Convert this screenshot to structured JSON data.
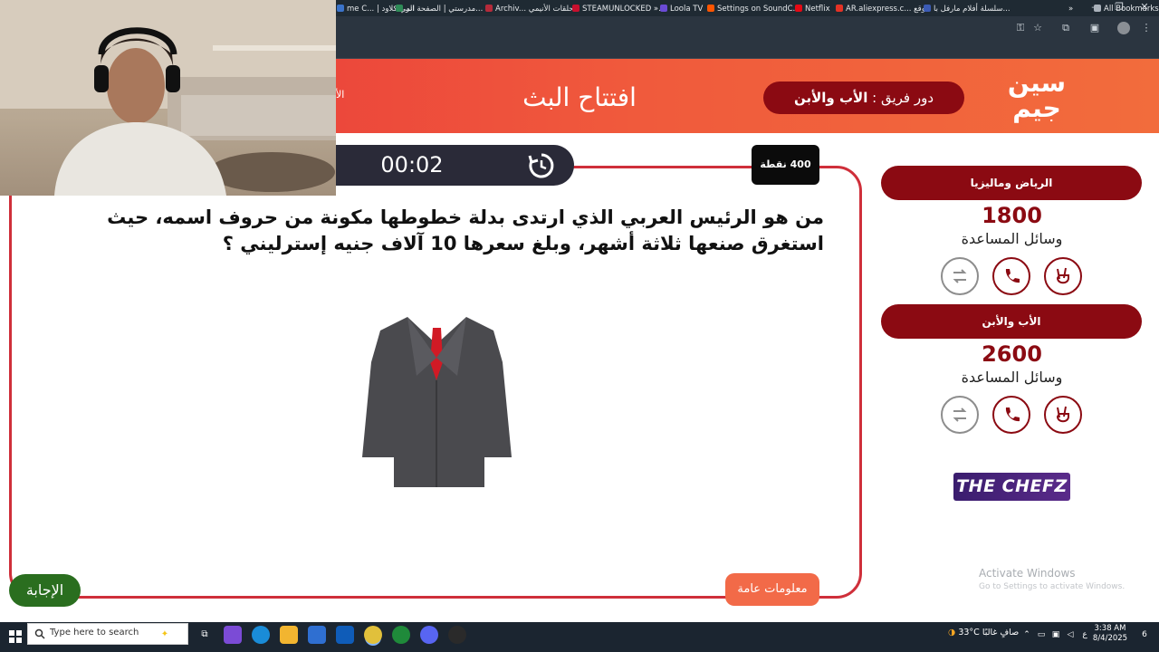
{
  "browser": {
    "window_controls": [
      "–",
      "❐",
      "✕"
    ],
    "bookmarks": [
      {
        "label": "me C... | انمي كلاود",
        "color": "#3b73c9"
      },
      {
        "label": "انمي كلاود | الصفحة الر...",
        "color": "#2e8b57"
      },
      {
        "label": "مدرستي | الصفحة الر...",
        "color": "#2e8b57"
      },
      {
        "label": "Archiv... حلقات الأنيمي",
        "color": "#b52a3a"
      },
      {
        "label": "STEAMUNLOCKED »...",
        "color": "#c8102e"
      },
      {
        "label": "Loola TV",
        "color": "#6b4bd6"
      },
      {
        "label": "Settings on SoundC...",
        "color": "#ff5500"
      },
      {
        "label": "Netflix",
        "color": "#e50914"
      },
      {
        "label": "AR.aliexpress.c... موقع",
        "color": "#e43225"
      },
      {
        "label": "سلسلة أفلام مارفل با...",
        "color": "#3b5bb5"
      },
      {
        "label": "All Bookmarks",
        "color": "#aab2bb"
      }
    ],
    "overflow_label": "»"
  },
  "header": {
    "stream_title": "افتتاح البث",
    "team_turn_prefix": "دور فريق : ",
    "team_turn_name": "الأب والأبن",
    "logo_text_top": "سين",
    "logo_text_bottom": "جيم",
    "clipped_text": "الأ"
  },
  "question_card": {
    "timer": "00:02",
    "points": "400 نقطة",
    "question": "من هو الرئيس العربي الذي ارتدى بدلة خطوطها مكونة من حروف اسمه، حيث استغرق صنعها ثلاثة أشهر، وبلغ سعرها 10 آلاف جنيه إسترليني ؟",
    "image_subject": "suit-jacket",
    "category": "معلومات عامة",
    "answer_button": "الإجابة"
  },
  "teams": [
    {
      "name": "الرياض وماليزيا",
      "score": "1800",
      "aids_label": "وسائل المساعدة",
      "aids": [
        {
          "icon": "swap-icon",
          "used": true
        },
        {
          "icon": "phone-icon",
          "used": false
        },
        {
          "icon": "two-fingers-icon",
          "used": false
        }
      ]
    },
    {
      "name": "الأب والأبن",
      "score": "2600",
      "aids_label": "وسائل المساعدة",
      "aids": [
        {
          "icon": "swap-icon",
          "used": true
        },
        {
          "icon": "phone-icon",
          "used": false
        },
        {
          "icon": "two-fingers-icon",
          "used": false
        }
      ]
    }
  ],
  "sponsor": "THE CHEFZ",
  "watermark": {
    "line1": "Activate Windows",
    "line2": "Go to Settings to activate Windows."
  },
  "taskbar": {
    "search_placeholder": "Type here to search",
    "weather": "33°C صافٍ غالبًا",
    "lang": "ع",
    "time": "3:38 AM",
    "date": "8/4/2025",
    "notification_count": "6"
  },
  "colors": {
    "accent_dark_red": "#8b0a12",
    "header_red": "#e8343a",
    "card_border": "#cf2f3a",
    "answer_green": "#2a6e1f",
    "category_orange": "#f26a48"
  }
}
